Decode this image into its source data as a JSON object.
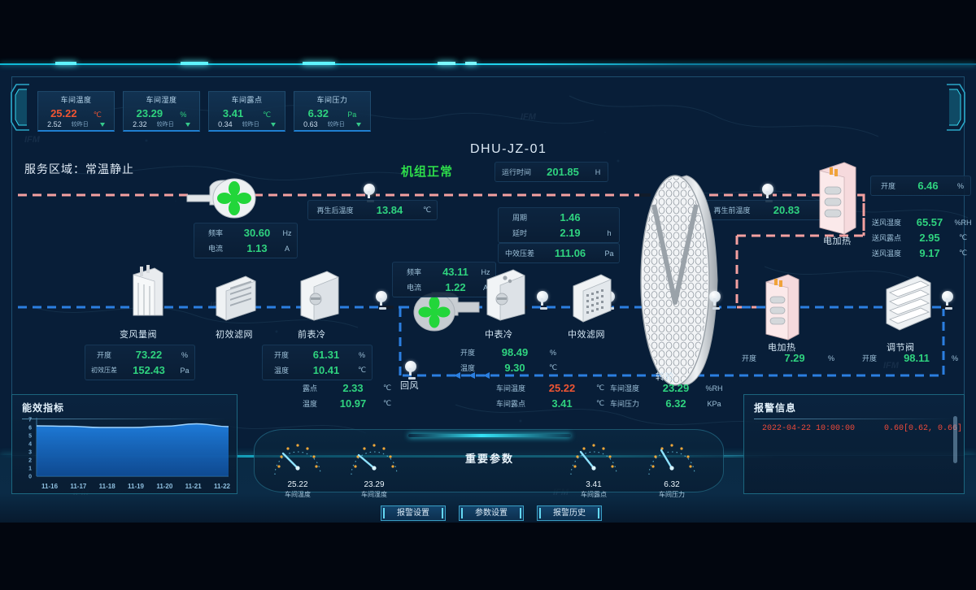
{
  "kpis": [
    {
      "title": "车间温度",
      "value": "25.22",
      "unit": "℃",
      "delta": "2.52",
      "compare": "较昨日",
      "tone": "red"
    },
    {
      "title": "车间湿度",
      "value": "23.29",
      "unit": "%",
      "delta": "2.32",
      "compare": "较昨日",
      "tone": "green"
    },
    {
      "title": "车间露点",
      "value": "3.41",
      "unit": "℃",
      "delta": "0.34",
      "compare": "较昨日",
      "tone": "green"
    },
    {
      "title": "车间压力",
      "value": "6.32",
      "unit": "Pa",
      "delta": "0.63",
      "compare": "较昨日",
      "tone": "green"
    }
  ],
  "header": {
    "service_area": "服务区域：常温静止",
    "unit_id": "DHU-JZ-01",
    "unit_status": "机组正常",
    "runtime_label": "运行时间",
    "runtime_value": "201.85",
    "runtime_unit": "H"
  },
  "regen": {
    "after_label": "再生后温度",
    "after_value": "13.84",
    "after_unit": "℃",
    "before_label": "再生前温度",
    "before_value": "20.83",
    "before_unit": "℃"
  },
  "cycle": {
    "period_label": "周期",
    "period_value": "1.46",
    "delay_label": "延时",
    "delay_value": "2.19",
    "delay_unit": "h",
    "mid_dp_label": "中效压差",
    "mid_dp_value": "111.06",
    "mid_dp_unit": "Pa"
  },
  "fan_regen": {
    "freq_label": "频率",
    "freq_value": "30.60",
    "freq_unit": "Hz",
    "cur_label": "电流",
    "cur_value": "1.13",
    "cur_unit": "A"
  },
  "fan_supply": {
    "freq_label": "频率",
    "freq_value": "43.11",
    "freq_unit": "Hz",
    "cur_label": "电流",
    "cur_value": "1.22",
    "cur_unit": "A"
  },
  "equipment": {
    "vav": {
      "name": "变风量阀",
      "open_label": "开度",
      "open_value": "73.22",
      "open_unit": "%",
      "dp_label": "初效压差",
      "dp_value": "152.43",
      "dp_unit": "Pa"
    },
    "pre_filter": {
      "name": "初效滤网"
    },
    "pre_cool": {
      "name": "前表冷",
      "open_label": "开度",
      "open_value": "61.31",
      "open_unit": "%",
      "temp_label": "温度",
      "temp_value": "10.41",
      "temp_unit": "℃",
      "dew_label": "露点",
      "dew_value": "2.33",
      "dew_unit": "℃",
      "temp2_label": "温度",
      "temp2_value": "10.97",
      "temp2_unit": "℃"
    },
    "return_air": {
      "name": "回风"
    },
    "mid_cool": {
      "name": "中表冷",
      "open_label": "开度",
      "open_value": "98.49",
      "open_unit": "%",
      "temp_label": "温度",
      "temp_value": "9.30",
      "temp_unit": "℃"
    },
    "mid_filter": {
      "name": "中效滤网"
    },
    "rotor": {
      "name": "转轮"
    },
    "heater_top": {
      "name": "电加热",
      "open_label": "开度",
      "open_value": "6.46",
      "open_unit": "%"
    },
    "heater_bottom": {
      "name": "电加热",
      "open_label": "开度",
      "open_value": "7.29",
      "open_unit": "%"
    },
    "damper": {
      "name": "调节阀",
      "open_label": "开度",
      "open_value": "98.11",
      "open_unit": "%"
    }
  },
  "supply_air": [
    {
      "label": "送风湿度",
      "value": "65.57",
      "unit": "%RH"
    },
    {
      "label": "送风露点",
      "value": "2.95",
      "unit": "℃"
    },
    {
      "label": "送风温度",
      "value": "9.17",
      "unit": "℃"
    }
  ],
  "room_readings": [
    {
      "label": "车间温度",
      "value": "25.22",
      "unit": "℃",
      "tone": "warn"
    },
    {
      "label": "车间湿度",
      "value": "23.29",
      "unit": "%RH",
      "tone": "ok"
    },
    {
      "label": "车间露点",
      "value": "3.41",
      "unit": "℃",
      "tone": "ok"
    },
    {
      "label": "车间压力",
      "value": "6.32",
      "unit": "KPa",
      "tone": "ok"
    }
  ],
  "energy_panel": {
    "title": "能效指标"
  },
  "alarm_panel": {
    "title": "报警信息",
    "rows": [
      {
        "time": "2022-04-22 10:00:00",
        "detail": "0.60[0.62, 0.66]"
      }
    ]
  },
  "gauges_band": {
    "center_label": "重要参数",
    "gauges": [
      {
        "value": "25.22",
        "label": "车间温度",
        "angle": -48
      },
      {
        "value": "23.29",
        "label": "车间湿度",
        "angle": -40
      },
      {
        "value": "3.41",
        "label": "车间露点",
        "angle": -30
      },
      {
        "value": "6.32",
        "label": "车间压力",
        "angle": -18
      }
    ]
  },
  "buttons": [
    {
      "label": "报警设置"
    },
    {
      "label": "参数设置"
    },
    {
      "label": "报警历史"
    }
  ],
  "watermark": "IFM",
  "chart_data": {
    "type": "area",
    "title": "能效指标",
    "categories": [
      "11-16",
      "11-17",
      "11-18",
      "11-19",
      "11-20",
      "11-21",
      "11-22"
    ],
    "values": [
      6.2,
      6.15,
      6.0,
      6.0,
      6.15,
      6.45,
      6.1
    ],
    "xlabel": "",
    "ylabel": "",
    "ylim": [
      0,
      7
    ],
    "yticks": [
      0,
      1,
      2,
      3,
      4,
      5,
      6,
      7
    ],
    "grid": false,
    "legend": "none"
  }
}
